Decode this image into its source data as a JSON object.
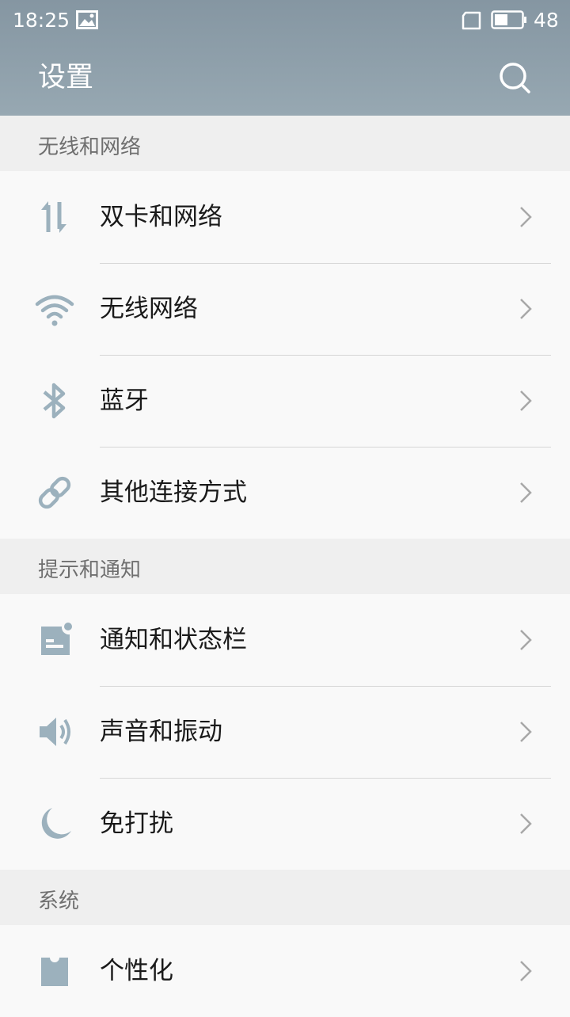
{
  "status_bar": {
    "time": "18:25",
    "battery_level": "48"
  },
  "header": {
    "title": "设置"
  },
  "sections": [
    {
      "title": "无线和网络",
      "items": [
        {
          "label": "双卡和网络",
          "icon": "dual-sim-arrows-icon"
        },
        {
          "label": "无线网络",
          "icon": "wifi-icon"
        },
        {
          "label": "蓝牙",
          "icon": "bluetooth-icon"
        },
        {
          "label": "其他连接方式",
          "icon": "link-icon"
        }
      ]
    },
    {
      "title": "提示和通知",
      "items": [
        {
          "label": "通知和状态栏",
          "icon": "notification-icon"
        },
        {
          "label": "声音和振动",
          "icon": "speaker-icon"
        },
        {
          "label": "免打扰",
          "icon": "moon-icon"
        }
      ]
    },
    {
      "title": "系统",
      "items": [
        {
          "label": "个性化",
          "icon": "shirt-icon"
        }
      ]
    }
  ],
  "colors": {
    "header_top": "#8596a2",
    "header_bottom": "#97a8b2",
    "icon": "#9cb1bd",
    "section_bg": "#efefef",
    "row_bg": "#f9f9f9"
  }
}
